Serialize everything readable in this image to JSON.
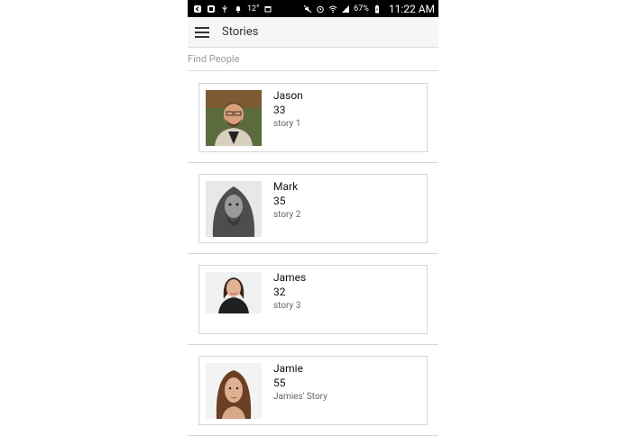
{
  "status_bar": {
    "temperature": "12°",
    "battery": "67%",
    "time": "11:22 AM"
  },
  "app_bar": {
    "title": "Stories"
  },
  "search": {
    "placeholder": "Find People"
  },
  "people": [
    {
      "name": "Jason",
      "age": "33",
      "story": "story 1"
    },
    {
      "name": "Mark",
      "age": "35",
      "story": "story 2"
    },
    {
      "name": "James",
      "age": "32",
      "story": "story 3"
    },
    {
      "name": "Jamie",
      "age": "55",
      "story": "Jamies' Story"
    }
  ]
}
